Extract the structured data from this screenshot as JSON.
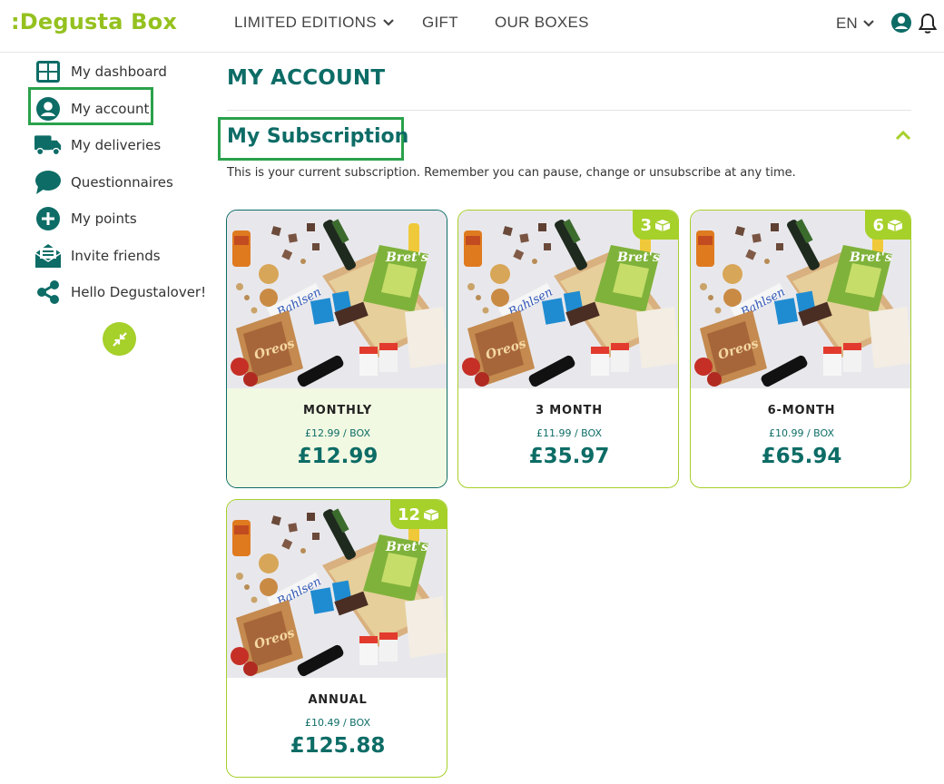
{
  "header": {
    "logo": ":Degusta Box",
    "nav": [
      {
        "label": "LIMITED EDITIONS",
        "has_dropdown": true
      },
      {
        "label": "GIFT"
      },
      {
        "label": "OUR BOXES"
      }
    ],
    "language": "EN"
  },
  "sidebar": {
    "items": [
      {
        "label": "My dashboard",
        "icon": "dashboard-icon"
      },
      {
        "label": "My account",
        "icon": "user-icon",
        "active": true
      },
      {
        "label": "My deliveries",
        "icon": "truck-icon"
      },
      {
        "label": "Questionnaires",
        "icon": "chat-icon"
      },
      {
        "label": "My points",
        "icon": "plus-circle-icon"
      },
      {
        "label": "Invite friends",
        "icon": "envelope-icon"
      },
      {
        "label": "Hello Degustalover!",
        "icon": "share-icon"
      }
    ]
  },
  "main": {
    "title": "MY ACCOUNT",
    "section_title": "My Subscription",
    "section_desc": "This is your current subscription. Remember you can pause, change or unsubscribe at any time.",
    "plans": [
      {
        "name": "MONTHLY",
        "per_box": "£12.99 / BOX",
        "price": "£12.99",
        "badge": "",
        "selected": true
      },
      {
        "name": "3 MONTH",
        "per_box": "£11.99 / BOX",
        "price": "£35.97",
        "badge": "3"
      },
      {
        "name": "6-MONTH",
        "per_box": "£10.99 / BOX",
        "price": "£65.94",
        "badge": "6"
      },
      {
        "name": "ANNUAL",
        "per_box": "£10.49 / BOX",
        "price": "£125.88",
        "badge": "12"
      }
    ]
  },
  "colors": {
    "brand_green": "#95c11f",
    "accent_green": "#a6d02a",
    "teal": "#0d6c66",
    "highlight": "#2aa14b"
  }
}
